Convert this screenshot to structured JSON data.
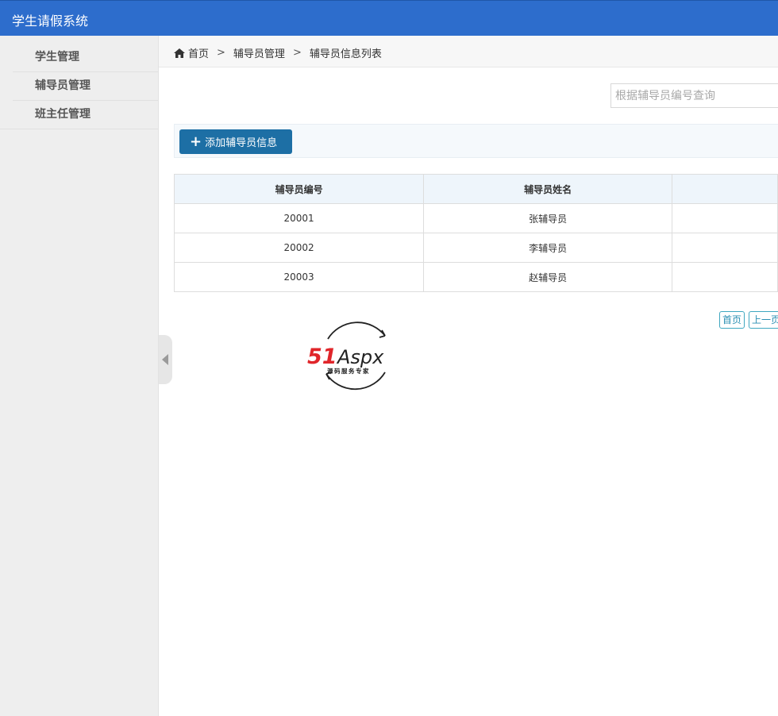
{
  "app": {
    "title": "学生请假系统"
  },
  "sidebar": {
    "items": [
      {
        "label": "学生管理"
      },
      {
        "label": "辅导员管理"
      },
      {
        "label": "班主任管理"
      }
    ]
  },
  "breadcrumb": {
    "items": [
      "首页",
      "辅导员管理",
      "辅导员信息列表"
    ],
    "separator": ">"
  },
  "search": {
    "placeholder": "根据辅导员编号查询",
    "value": ""
  },
  "toolbar": {
    "add_label": "添加辅导员信息",
    "add_icon": "plus-icon"
  },
  "table": {
    "headers": [
      "辅导员编号",
      "辅导员姓名",
      ""
    ],
    "rows": [
      [
        "20001",
        "张辅导员",
        ""
      ],
      [
        "20002",
        "李辅导员",
        ""
      ],
      [
        "20003",
        "赵辅导员",
        ""
      ]
    ]
  },
  "pager": {
    "first_label": "首页",
    "prev_label": "上一页"
  },
  "logo": {
    "text": "51Aspx",
    "subtitle": "源码服务专家"
  },
  "colors": {
    "header": "#2d6dcc",
    "button": "#1d6fa5",
    "pager_border": "#3fa7c0",
    "logo_red": "#e0252a",
    "logo_green": "#2e9a3e"
  }
}
